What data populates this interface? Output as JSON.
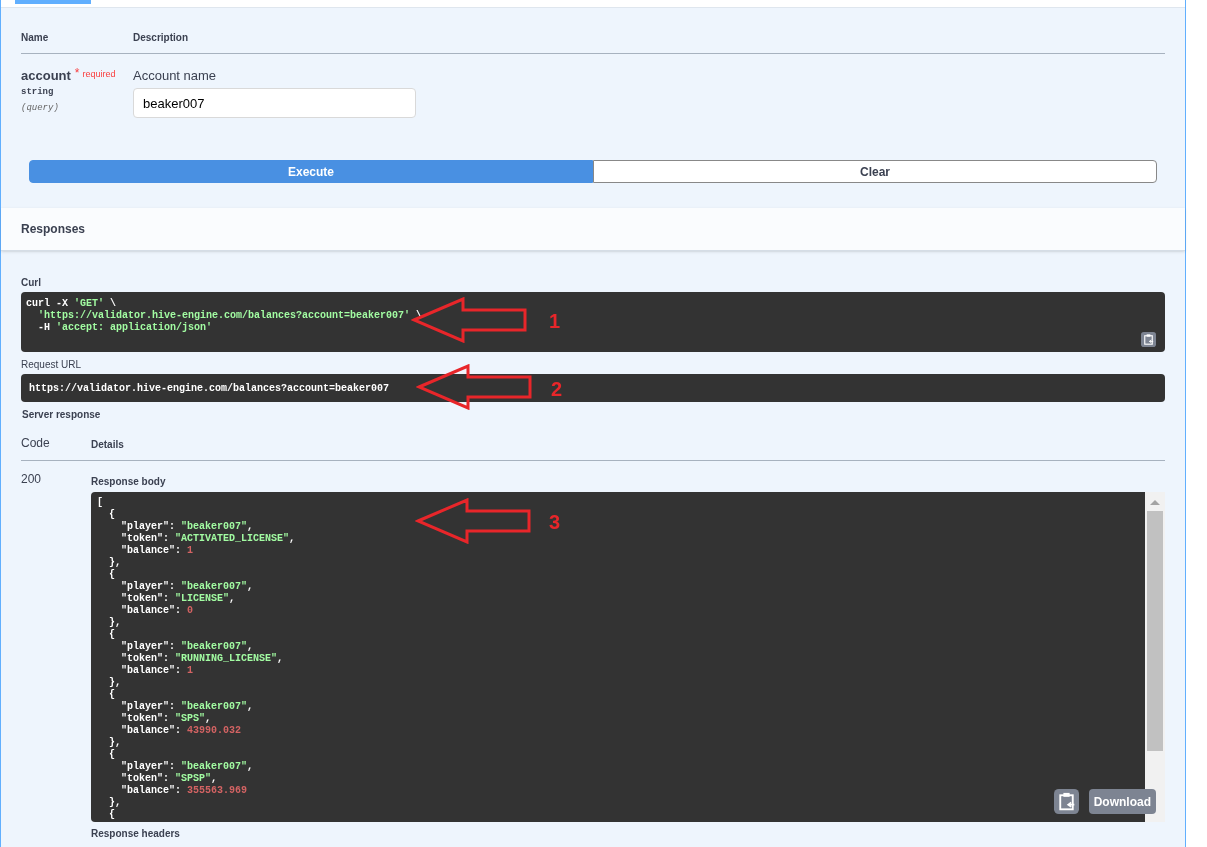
{
  "parameters": {
    "columns": [
      "Name",
      "Description"
    ],
    "rows": [
      {
        "name": "account",
        "required_mark": "*",
        "required_label": "required",
        "type": "string",
        "location": "(query)",
        "description": "Account name",
        "value": "beaker007"
      }
    ]
  },
  "buttons": [
    {
      "label": "Execute",
      "kind": "primary"
    },
    {
      "label": "Clear",
      "kind": "secondary"
    }
  ],
  "responses": {
    "title": "Responses",
    "curl": {
      "label": "Curl",
      "lines": [
        {
          "indented": false,
          "segments": [
            {
              "kind": "plain",
              "text": "curl -X "
            },
            {
              "kind": "string",
              "text": "'GET'"
            },
            {
              "kind": "plain",
              "text": " \\"
            }
          ]
        },
        {
          "indented": true,
          "segments": [
            {
              "kind": "string",
              "text": "'https://validator.hive-engine.com/balances?account=beaker007'"
            },
            {
              "kind": "plain",
              "text": " \\"
            }
          ]
        },
        {
          "indented": true,
          "segments": [
            {
              "kind": "plain",
              "text": "-H "
            },
            {
              "kind": "string",
              "text": "'accept: application/json'"
            }
          ]
        }
      ]
    },
    "request_url": {
      "label": "Request URL",
      "value": "https://validator.hive-engine.com/balances?account=beaker007"
    },
    "server_response": {
      "label": "Server response",
      "columns": [
        "Code",
        "Details"
      ],
      "code": "200",
      "body_label": "Response body",
      "body": {
        "open": "[",
        "items": [
          {
            "open": "{",
            "fields": [
              {
                "key": "\"player\"",
                "sep": ": ",
                "value": "\"beaker007\"",
                "kind": "string",
                "end": ","
              },
              {
                "key": "\"token\"",
                "sep": ": ",
                "value": "\"ACTIVATED_LICENSE\"",
                "kind": "string",
                "end": ","
              },
              {
                "key": "\"balance\"",
                "sep": ": ",
                "value": "1",
                "kind": "number"
              }
            ],
            "close": "},"
          },
          {
            "open": "{",
            "fields": [
              {
                "key": "\"player\"",
                "sep": ": ",
                "value": "\"beaker007\"",
                "kind": "string",
                "end": ","
              },
              {
                "key": "\"token\"",
                "sep": ": ",
                "value": "\"LICENSE\"",
                "kind": "string",
                "end": ","
              },
              {
                "key": "\"balance\"",
                "sep": ": ",
                "value": "0",
                "kind": "number"
              }
            ],
            "close": "},"
          },
          {
            "open": "{",
            "fields": [
              {
                "key": "\"player\"",
                "sep": ": ",
                "value": "\"beaker007\"",
                "kind": "string",
                "end": ","
              },
              {
                "key": "\"token\"",
                "sep": ": ",
                "value": "\"RUNNING_LICENSE\"",
                "kind": "string",
                "end": ","
              },
              {
                "key": "\"balance\"",
                "sep": ": ",
                "value": "1",
                "kind": "number"
              }
            ],
            "close": "},"
          },
          {
            "open": "{",
            "fields": [
              {
                "key": "\"player\"",
                "sep": ": ",
                "value": "\"beaker007\"",
                "kind": "string",
                "end": ","
              },
              {
                "key": "\"token\"",
                "sep": ": ",
                "value": "\"SPS\"",
                "kind": "string",
                "end": ","
              },
              {
                "key": "\"balance\"",
                "sep": ": ",
                "value": "43990.032",
                "kind": "number"
              }
            ],
            "close": "},"
          },
          {
            "open": "{",
            "fields": [
              {
                "key": "\"player\"",
                "sep": ": ",
                "value": "\"beaker007\"",
                "kind": "string",
                "end": ","
              },
              {
                "key": "\"token\"",
                "sep": ": ",
                "value": "\"SPSP\"",
                "kind": "string",
                "end": ","
              },
              {
                "key": "\"balance\"",
                "sep": ": ",
                "value": "355563.969",
                "kind": "number"
              }
            ],
            "close": "},"
          },
          {
            "open": "{"
          }
        ]
      },
      "download": "Download",
      "headers_label": "Response headers"
    }
  },
  "annotations": [
    {
      "label": "1"
    },
    {
      "label": "2"
    },
    {
      "label": "3"
    }
  ]
}
